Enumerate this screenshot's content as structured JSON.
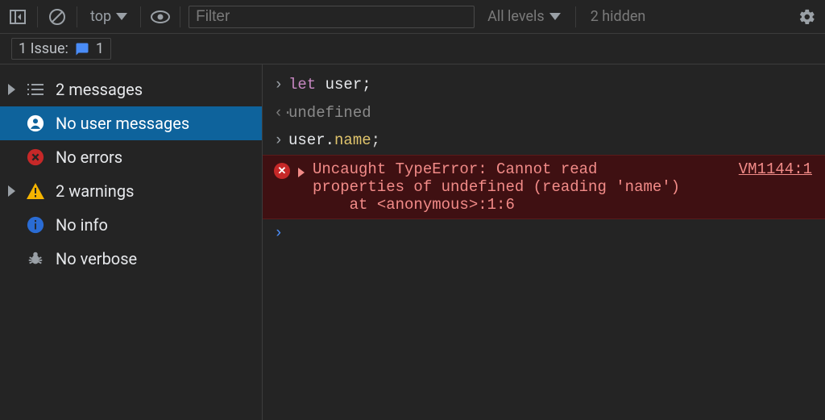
{
  "toolbar": {
    "context": "top",
    "filter_placeholder": "Filter",
    "levels_label": "All levels",
    "hidden_label": "2 hidden"
  },
  "issues": {
    "label": "1 Issue:",
    "count": "1"
  },
  "sidebar": {
    "items": [
      {
        "label": "2 messages",
        "icon": "list",
        "disclosure": true,
        "selected": false
      },
      {
        "label": "No user messages",
        "icon": "person",
        "disclosure": false,
        "selected": true
      },
      {
        "label": "No errors",
        "icon": "error",
        "disclosure": false,
        "selected": false
      },
      {
        "label": "2 warnings",
        "icon": "warning",
        "disclosure": true,
        "selected": false
      },
      {
        "label": "No info",
        "icon": "info",
        "disclosure": false,
        "selected": false
      },
      {
        "label": "No verbose",
        "icon": "bug",
        "disclosure": false,
        "selected": false
      }
    ]
  },
  "console": {
    "line1": {
      "keyword": "let",
      "rest": " user;"
    },
    "line1_result": "undefined",
    "line2_pre": "user.",
    "line2_prop": "name",
    "line2_post": ";",
    "error": {
      "message": "Uncaught TypeError: Cannot read \nproperties of undefined (reading 'name')\n    at <anonymous>:1:6",
      "source": "VM1144:1"
    }
  }
}
